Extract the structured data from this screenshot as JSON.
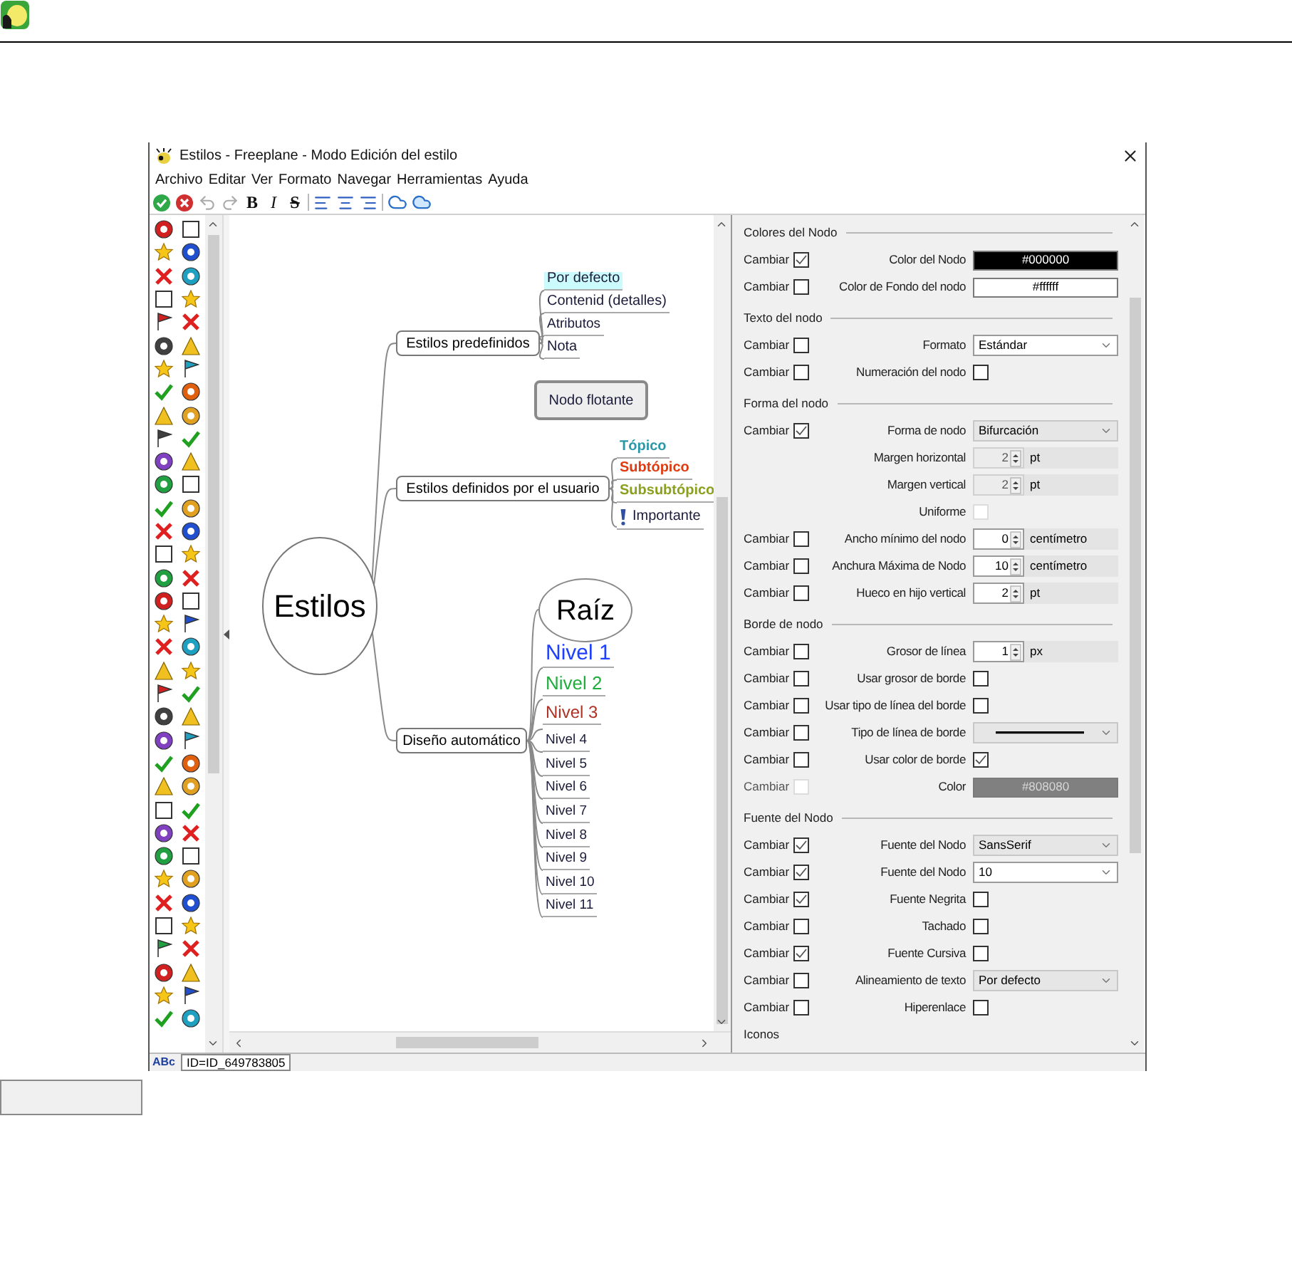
{
  "window": {
    "title": "Estilos - Freeplane - Modo Edición del estilo"
  },
  "menu": [
    "Archivo",
    "Editar",
    "Ver",
    "Formato",
    "Navegar",
    "Herramientas",
    "Ayuda"
  ],
  "toolbar": {
    "format_buttons": [
      "B",
      "I",
      "S"
    ]
  },
  "map": {
    "root": "Estilos",
    "branches": [
      {
        "label": "Estilos predefinidos",
        "children": [
          {
            "label": "Por defecto",
            "kind": "text",
            "selected": true,
            "color": "#1a1a3a"
          },
          {
            "label": "Contenid (detalles)",
            "kind": "text",
            "selected": false,
            "color": "#1a1a3a"
          },
          {
            "label": "Atributos",
            "kind": "text",
            "selected": false,
            "color": "#1a1a3a"
          },
          {
            "label": "Nota",
            "kind": "text",
            "selected": false,
            "color": "#1a1a3a"
          },
          {
            "label": "Nodo flotante",
            "kind": "floating",
            "selected": false,
            "color": "#1a1a3a"
          }
        ]
      },
      {
        "label": "Estilos definidos por el usuario",
        "children": [
          {
            "label": "Tópico",
            "kind": "text",
            "selected": false,
            "color": "#2a98a8"
          },
          {
            "label": "Subtópico",
            "kind": "text",
            "selected": false,
            "color": "#e03a12"
          },
          {
            "label": "Subsubtópico",
            "kind": "text",
            "selected": false,
            "color": "#8aa01e"
          },
          {
            "label": "Importante",
            "kind": "marked",
            "selected": false,
            "color": "#1a1a3a"
          }
        ]
      },
      {
        "label": "Diseño automático",
        "children": [
          {
            "label": "Raíz",
            "kind": "oval",
            "selected": false,
            "color": "#000000"
          },
          {
            "label": "Nivel 1",
            "kind": "text",
            "selected": false,
            "color": "#2040ff"
          },
          {
            "label": "Nivel 2",
            "kind": "text",
            "selected": false,
            "color": "#1fae3c"
          },
          {
            "label": "Nivel 3",
            "kind": "text",
            "selected": false,
            "color": "#b03224"
          },
          {
            "label": "Nivel 4",
            "kind": "text",
            "selected": false,
            "color": "#1a1a3a"
          },
          {
            "label": "Nivel 5",
            "kind": "text",
            "selected": false,
            "color": "#1a1a3a"
          },
          {
            "label": "Nivel 6",
            "kind": "text",
            "selected": false,
            "color": "#1a1a3a"
          },
          {
            "label": "Nivel 7",
            "kind": "text",
            "selected": false,
            "color": "#1a1a3a"
          },
          {
            "label": "Nivel 8",
            "kind": "text",
            "selected": false,
            "color": "#1a1a3a"
          },
          {
            "label": "Nivel 9",
            "kind": "text",
            "selected": false,
            "color": "#1a1a3a"
          },
          {
            "label": "Nivel 10",
            "kind": "text",
            "selected": false,
            "color": "#1a1a3a"
          },
          {
            "label": "Nivel 11",
            "kind": "text",
            "selected": false,
            "color": "#1a1a3a"
          }
        ]
      }
    ]
  },
  "properties": {
    "sections": [
      {
        "title": "Colores del Nodo",
        "rows": [
          {
            "kind": "color",
            "change": "Cambiar",
            "changed": true,
            "change_disabled": false,
            "label": "Color del Nodo",
            "value": "#000000",
            "disabled": false
          },
          {
            "kind": "color",
            "change": "Cambiar",
            "changed": false,
            "change_disabled": false,
            "label": "Color de Fondo del nodo",
            "value": "#ffffff",
            "disabled": false
          }
        ]
      },
      {
        "title": "Texto del nodo",
        "rows": [
          {
            "kind": "dropdown",
            "change": "Cambiar",
            "changed": false,
            "change_disabled": false,
            "label": "Formato",
            "value": "Estándar",
            "editable": true
          },
          {
            "kind": "checkbox",
            "change": "Cambiar",
            "changed": false,
            "change_disabled": false,
            "label": "Numeración del nodo",
            "checked": false,
            "disabled": false
          }
        ]
      },
      {
        "title": "Forma del nodo",
        "rows": [
          {
            "kind": "dropdown",
            "change": "Cambiar",
            "changed": true,
            "change_disabled": false,
            "label": "Forma de nodo",
            "value": "Bifurcación",
            "editable": false
          },
          {
            "kind": "spinner",
            "label": "Margen horizontal",
            "value": "2",
            "unit": "pt",
            "disabled": true
          },
          {
            "kind": "spinner",
            "label": "Margen vertical",
            "value": "2",
            "unit": "pt",
            "disabled": true
          },
          {
            "kind": "checkbox",
            "label": "Uniforme",
            "checked": false,
            "disabled": true
          },
          {
            "kind": "spinner",
            "change": "Cambiar",
            "changed": false,
            "change_disabled": false,
            "label": "Ancho mínimo del nodo",
            "value": "0",
            "unit": "centímetro",
            "disabled": false
          },
          {
            "kind": "spinner",
            "change": "Cambiar",
            "changed": false,
            "change_disabled": false,
            "label": "Anchura Máxima de Nodo",
            "value": "10",
            "unit": "centímetro",
            "disabled": false
          },
          {
            "kind": "spinner",
            "change": "Cambiar",
            "changed": false,
            "change_disabled": false,
            "label": "Hueco en hijo vertical",
            "value": "2",
            "unit": "pt",
            "disabled": false
          }
        ]
      },
      {
        "title": "Borde de nodo",
        "rows": [
          {
            "kind": "spinner",
            "change": "Cambiar",
            "changed": false,
            "change_disabled": false,
            "label": "Grosor de línea",
            "value": "1",
            "unit": "px",
            "disabled": false
          },
          {
            "kind": "checkbox",
            "change": "Cambiar",
            "changed": false,
            "change_disabled": false,
            "label": "Usar grosor de borde",
            "checked": false,
            "disabled": false
          },
          {
            "kind": "checkbox",
            "change": "Cambiar",
            "changed": false,
            "change_disabled": false,
            "label": "Usar tipo de línea del borde",
            "checked": false,
            "disabled": false
          },
          {
            "kind": "line_dropdown",
            "change": "Cambiar",
            "changed": false,
            "change_disabled": false,
            "label": "Tipo de línea de borde"
          },
          {
            "kind": "checkbox",
            "change": "Cambiar",
            "changed": false,
            "change_disabled": false,
            "label": "Usar color de borde",
            "checked": true,
            "disabled": false
          },
          {
            "kind": "color",
            "change": "Cambiar",
            "changed": false,
            "change_disabled": true,
            "label": "Color",
            "value": "#808080",
            "disabled": true
          }
        ]
      },
      {
        "title": "Fuente del Nodo",
        "rows": [
          {
            "kind": "dropdown",
            "change": "Cambiar",
            "changed": true,
            "change_disabled": false,
            "label": "Fuente del Nodo",
            "value": "SansSerif",
            "editable": false
          },
          {
            "kind": "dropdown",
            "change": "Cambiar",
            "changed": true,
            "change_disabled": false,
            "label": "Fuente del Nodo",
            "value": "10",
            "editable": true
          },
          {
            "kind": "checkbox",
            "change": "Cambiar",
            "changed": true,
            "change_disabled": false,
            "label": "Fuente Negrita",
            "checked": false,
            "disabled": false
          },
          {
            "kind": "checkbox",
            "change": "Cambiar",
            "changed": false,
            "change_disabled": false,
            "label": "Tachado",
            "checked": false,
            "disabled": false
          },
          {
            "kind": "checkbox",
            "change": "Cambiar",
            "changed": true,
            "change_disabled": false,
            "label": "Fuente Cursiva",
            "checked": false,
            "disabled": false
          },
          {
            "kind": "dropdown",
            "change": "Cambiar",
            "changed": false,
            "change_disabled": false,
            "label": "Alineamiento de texto",
            "value": "Por defecto",
            "editable": false
          },
          {
            "kind": "checkbox",
            "change": "Cambiar",
            "changed": false,
            "change_disabled": false,
            "label": "Hiperenlace",
            "checked": false,
            "disabled": false
          }
        ]
      }
    ],
    "next_section": "Iconos"
  },
  "status_bar": {
    "mode": "ABc",
    "id": "ID=ID_649783805"
  }
}
